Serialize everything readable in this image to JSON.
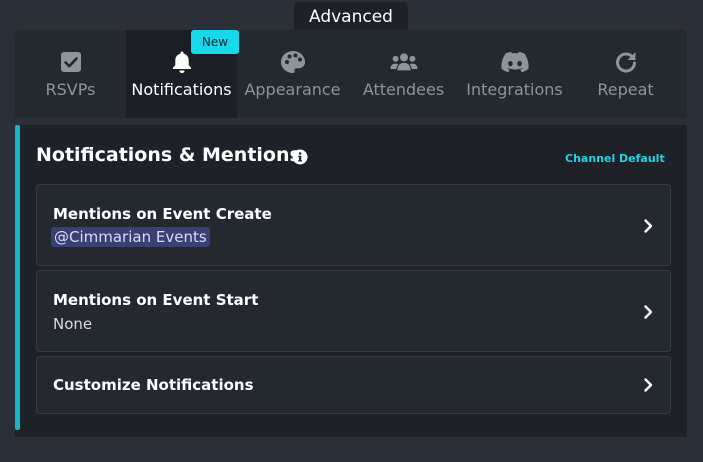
{
  "section_tab": {
    "label": "Advanced"
  },
  "tabs": [
    {
      "label": "RSVPs",
      "icon": "checkbox-icon"
    },
    {
      "label": "Notifications",
      "icon": "bell-icon",
      "active": true
    },
    {
      "label": "Appearance",
      "icon": "palette-icon"
    },
    {
      "label": "Attendees",
      "icon": "users-icon"
    },
    {
      "label": "Integrations",
      "icon": "discord-icon"
    },
    {
      "label": "Repeat",
      "icon": "repeat-icon"
    }
  ],
  "badge": {
    "label": "New"
  },
  "section": {
    "title": "Notifications & Mentions",
    "channel_default": "Channel Default"
  },
  "cards": [
    {
      "title": "Mentions on Event Create",
      "value": "@Cimmarian Events"
    },
    {
      "title": "Mentions on Event Start",
      "value": "None"
    },
    {
      "title": "Customize Notifications"
    }
  ],
  "colors": {
    "accent": "#17b6c4",
    "badge": "#18d8ec",
    "mention_bg": "#3b4073"
  }
}
